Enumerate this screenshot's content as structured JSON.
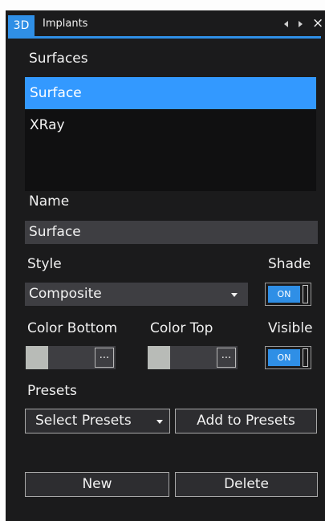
{
  "tabs": {
    "active": "3D",
    "title": "Implants",
    "close": "×"
  },
  "surfaces": {
    "label": "Surfaces",
    "items": [
      "Surface",
      "XRay"
    ],
    "selected": "Surface"
  },
  "name": {
    "label": "Name",
    "value": "Surface"
  },
  "style": {
    "label": "Style",
    "value": "Composite"
  },
  "shade": {
    "label": "Shade",
    "state": "ON"
  },
  "color_bottom": {
    "label": "Color Bottom",
    "swatch": "#b8bbb7",
    "button": "..."
  },
  "color_top": {
    "label": "Color Top",
    "swatch": "#b8bbb7",
    "button": "..."
  },
  "visible": {
    "label": "Visible",
    "state": "ON"
  },
  "presets": {
    "label": "Presets",
    "select": "Select Presets",
    "add": "Add to Presets"
  },
  "actions": {
    "new": "New",
    "delete": "Delete"
  },
  "colors": {
    "accent": "#2f8fe6",
    "selection": "#3399ff",
    "panel_bg": "#1b1b1c",
    "field_bg": "#3e3e42"
  }
}
